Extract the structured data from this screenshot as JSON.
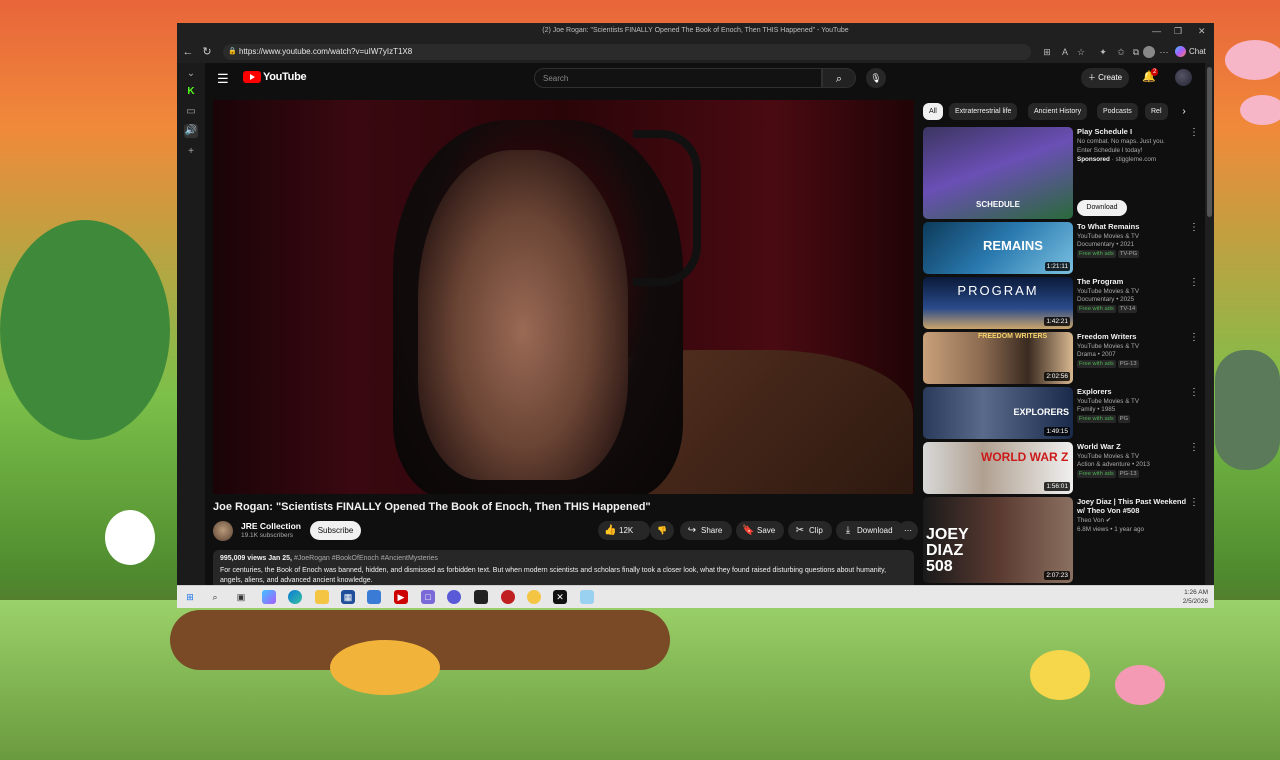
{
  "browser": {
    "window_title": "(2) Joe Rogan: \"Scientists FINALLY Opened The Book of Enoch, Then THIS Happened\" - YouTube",
    "url": "https://www.youtube.com/watch?v=uIW7yIzT1X8",
    "chat_label": "Chat"
  },
  "yt": {
    "logo_text": "YouTube",
    "search_placeholder": "Search",
    "create_label": "Create",
    "notification_count": "2"
  },
  "video": {
    "title": "Joe Rogan: \"Scientists FINALLY Opened The Book of Enoch, Then THIS Happened\"",
    "channel_name": "JRE Collection",
    "subscribers": "19.1K subscribers",
    "subscribe_label": "Subscribe",
    "like_count": "12K",
    "share_label": "Share",
    "save_label": "Save",
    "clip_label": "Clip",
    "download_label": "Download",
    "views_date": "995,009 views  Jan 25,",
    "hashtags": "#JoeRogan #BookOfEnoch #AncientMysteries",
    "description": "For centuries, the Book of Enoch was banned, hidden, and dismissed as forbidden text. But when modern scientists and scholars finally took a closer look, what they found raised disturbing questions about humanity, angels, aliens, and advanced ancient knowledge."
  },
  "chips": [
    "All",
    "Extraterrestrial life",
    "Ancient History",
    "Podcasts",
    "Rel"
  ],
  "ad": {
    "title": "Play Schedule I",
    "line1": "No combat. No maps. Just you.",
    "line2": "Enter Schedule I today!",
    "sponsored": "Sponsored",
    "domain": "stiggleme.com",
    "thumb_text": "SCHEDULE",
    "download_label": "Download"
  },
  "recommendations": [
    {
      "title": "To What Remains",
      "channel": "YouTube Movies & TV",
      "meta": "Documentary • 2021",
      "badges": [
        "Free with ads",
        "TV-PG"
      ],
      "duration": "1:21:11",
      "thumb_text": "REMAINS"
    },
    {
      "title": "The Program",
      "channel": "YouTube Movies & TV",
      "meta": "Documentary • 2025",
      "badges": [
        "Free with ads",
        "TV-14"
      ],
      "duration": "1:42:21",
      "thumb_text": "PROGRAM"
    },
    {
      "title": "Freedom Writers",
      "channel": "YouTube Movies & TV",
      "meta": "Drama • 2007",
      "badges": [
        "Free with ads",
        "PG-13"
      ],
      "duration": "2:02:56",
      "thumb_text": "FREEDOM WRITERS"
    },
    {
      "title": "Explorers",
      "channel": "YouTube Movies & TV",
      "meta": "Family • 1985",
      "badges": [
        "Free with ads",
        "PG"
      ],
      "duration": "1:49:15",
      "thumb_text": "EXPLORERS"
    },
    {
      "title": "World War Z",
      "channel": "YouTube Movies & TV",
      "meta": "Action & adventure • 2013",
      "badges": [
        "Free with ads",
        "PG-13"
      ],
      "duration": "1:56:01",
      "thumb_text": "WORLD WAR Z"
    },
    {
      "title": "Joey Diaz | This Past Weekend w/ Theo Von #508",
      "channel": "Theo Von",
      "meta": "6.8M views • 1 year ago",
      "badges": [],
      "duration": "2:07:23",
      "thumb_text": "JOEY DIAZ 508"
    }
  ],
  "taskbar": {
    "time": "1:26 AM",
    "date": "2/5/2026"
  }
}
